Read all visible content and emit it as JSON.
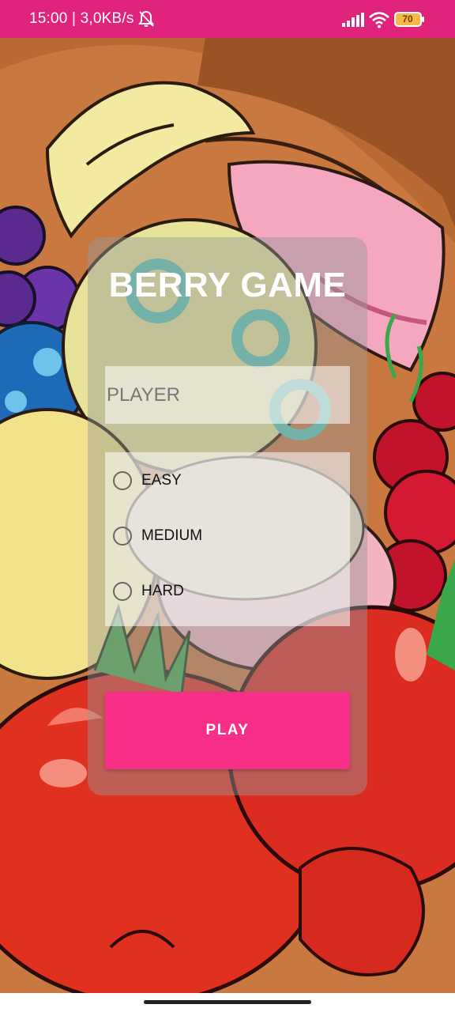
{
  "status_bar": {
    "time_speed": "15:00 | 3,0KB/s",
    "battery": "70",
    "icons": [
      "bell-muted-icon",
      "signal-icon",
      "wifi-icon",
      "battery-icon"
    ],
    "color": "#e0247c"
  },
  "background": {
    "description_icon": "fruit-illustration"
  },
  "card": {
    "title": "BERRY GAME",
    "player_input": {
      "placeholder": "PLAYER",
      "value": ""
    },
    "difficulty": {
      "options": [
        "EASY",
        "MEDIUM",
        "HARD"
      ],
      "selected": null
    },
    "play_button": "PLAY"
  },
  "colors": {
    "accent": "#f72f86",
    "status_bar": "#e0247c"
  }
}
